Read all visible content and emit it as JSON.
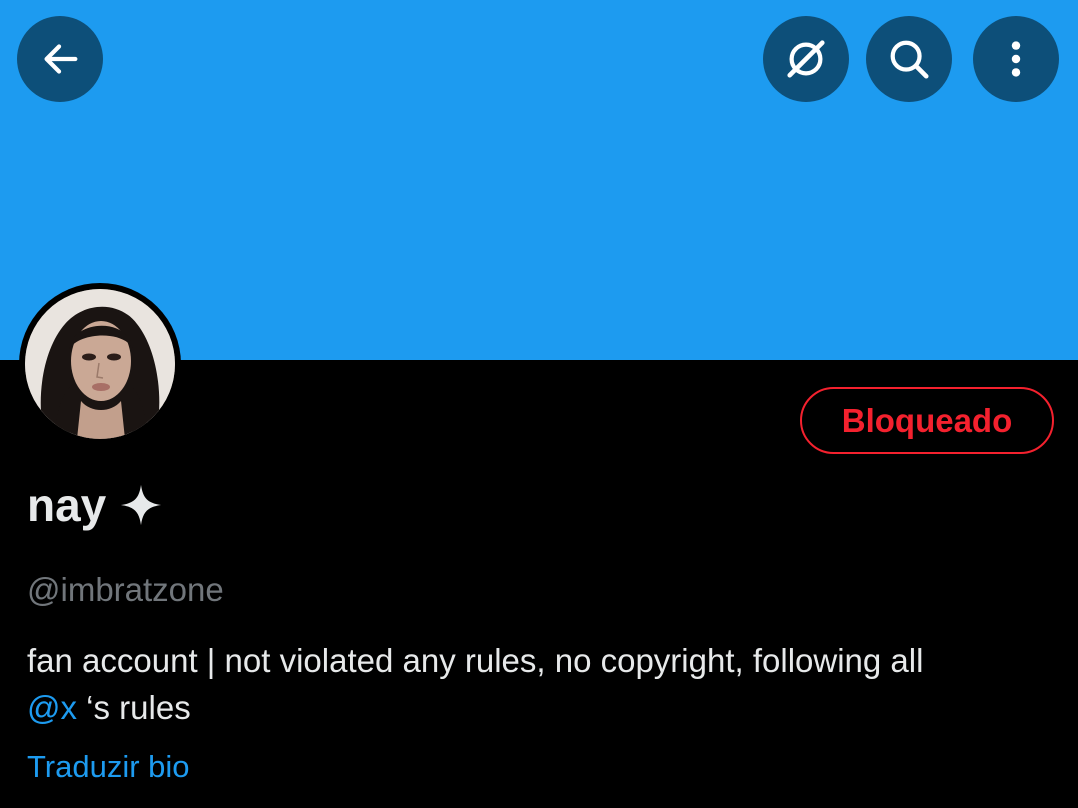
{
  "profile": {
    "display_name": "nay",
    "handle": "@imbratzone",
    "bio_text": "fan account | not violated any rules, no copyright, following all",
    "bio_mention": "@x",
    "bio_suffix": " ‘s rules",
    "translate_label": "Traduzir bio"
  },
  "actions": {
    "blocked_label": "Bloqueado"
  },
  "icons": {
    "back": "arrow-left-icon",
    "grok": "grok-icon",
    "search": "search-icon",
    "more": "more-vertical-icon",
    "badge": "sparkle-icon"
  },
  "colors": {
    "banner": "#1d9bf0",
    "blocked": "#f4212e",
    "link": "#1d9bf0",
    "muted": "#71767b"
  }
}
